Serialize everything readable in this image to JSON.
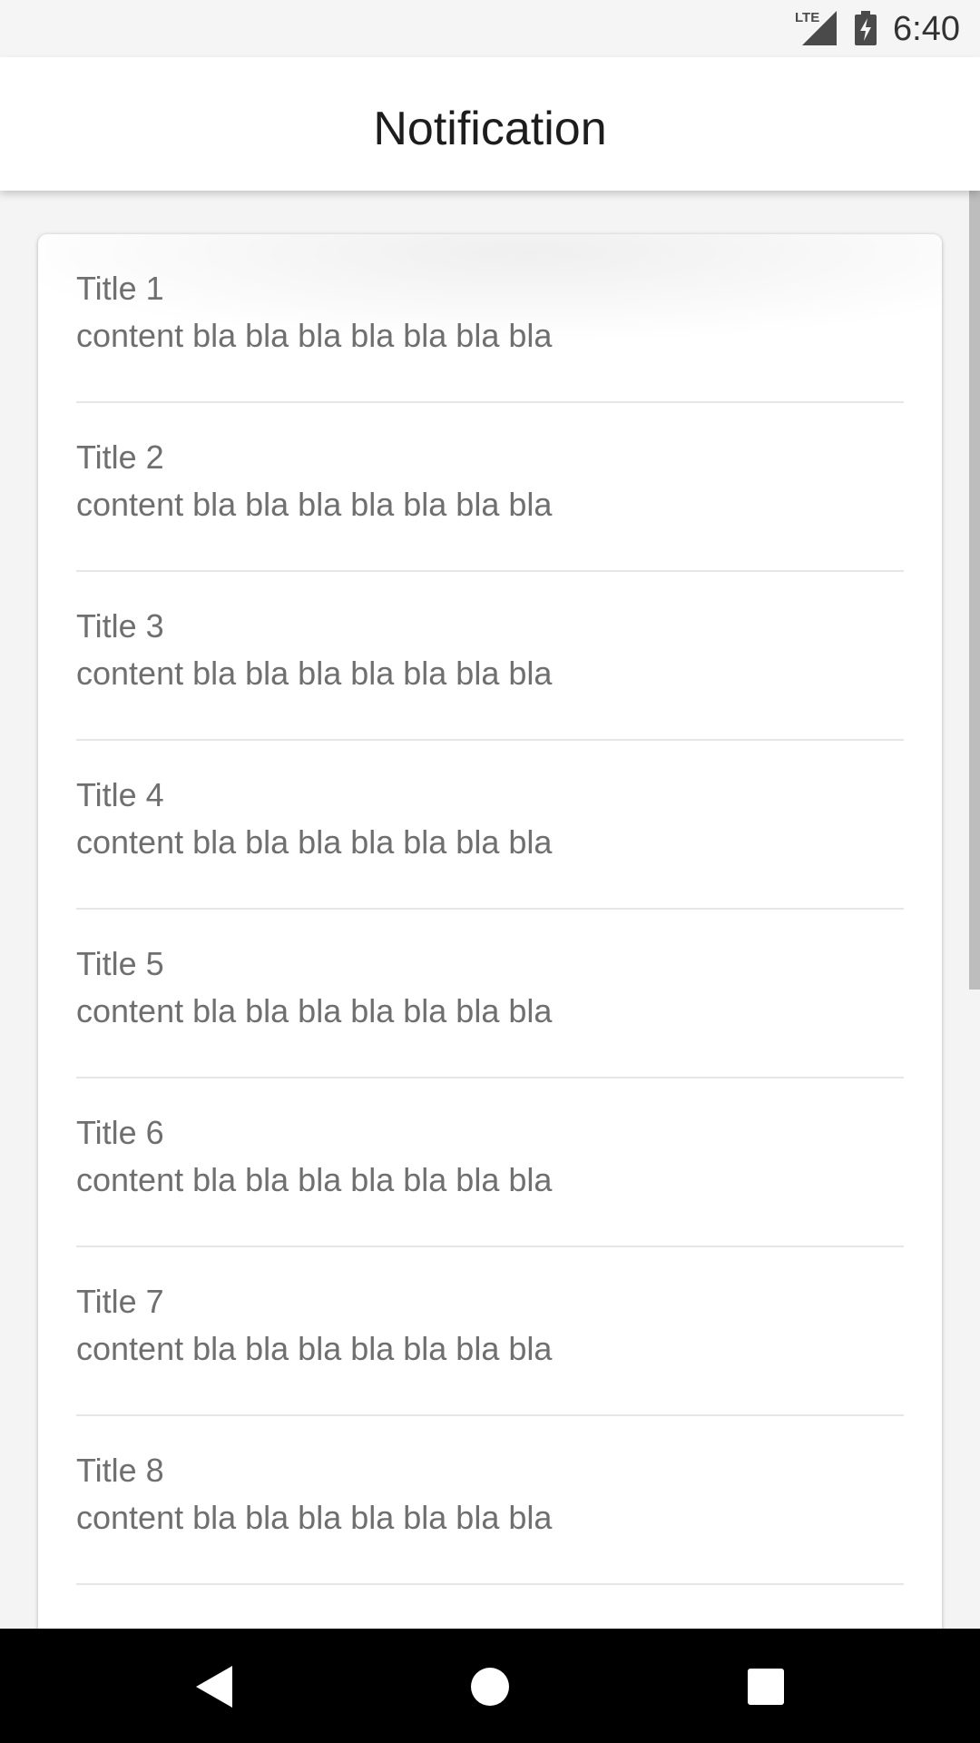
{
  "status_bar": {
    "network_label": "LTE",
    "time": "6:40",
    "icons": [
      "lte-signal-icon",
      "battery-charging-icon"
    ]
  },
  "app_bar": {
    "title": "Notification"
  },
  "notifications": [
    {
      "title": "Title 1",
      "content": "content bla bla bla bla bla bla bla"
    },
    {
      "title": "Title 2",
      "content": "content bla bla bla bla bla bla bla"
    },
    {
      "title": "Title 3",
      "content": "content bla bla bla bla bla bla bla"
    },
    {
      "title": "Title 4",
      "content": "content bla bla bla bla bla bla bla"
    },
    {
      "title": "Title 5",
      "content": "content bla bla bla bla bla bla bla"
    },
    {
      "title": "Title 6",
      "content": "content bla bla bla bla bla bla bla"
    },
    {
      "title": "Title 7",
      "content": "content bla bla bla bla bla bla bla"
    },
    {
      "title": "Title 8",
      "content": "content bla bla bla bla bla bla bla"
    },
    {
      "title": "",
      "content": ""
    }
  ],
  "nav_bar": {
    "buttons": [
      "back-icon",
      "home-icon",
      "recents-icon"
    ]
  },
  "colors": {
    "background": "#f4f4f4",
    "card": "#ffffff",
    "text_primary": "#1d1d1d",
    "text_secondary": "#6f6f6f",
    "nav_bar": "#000000"
  }
}
